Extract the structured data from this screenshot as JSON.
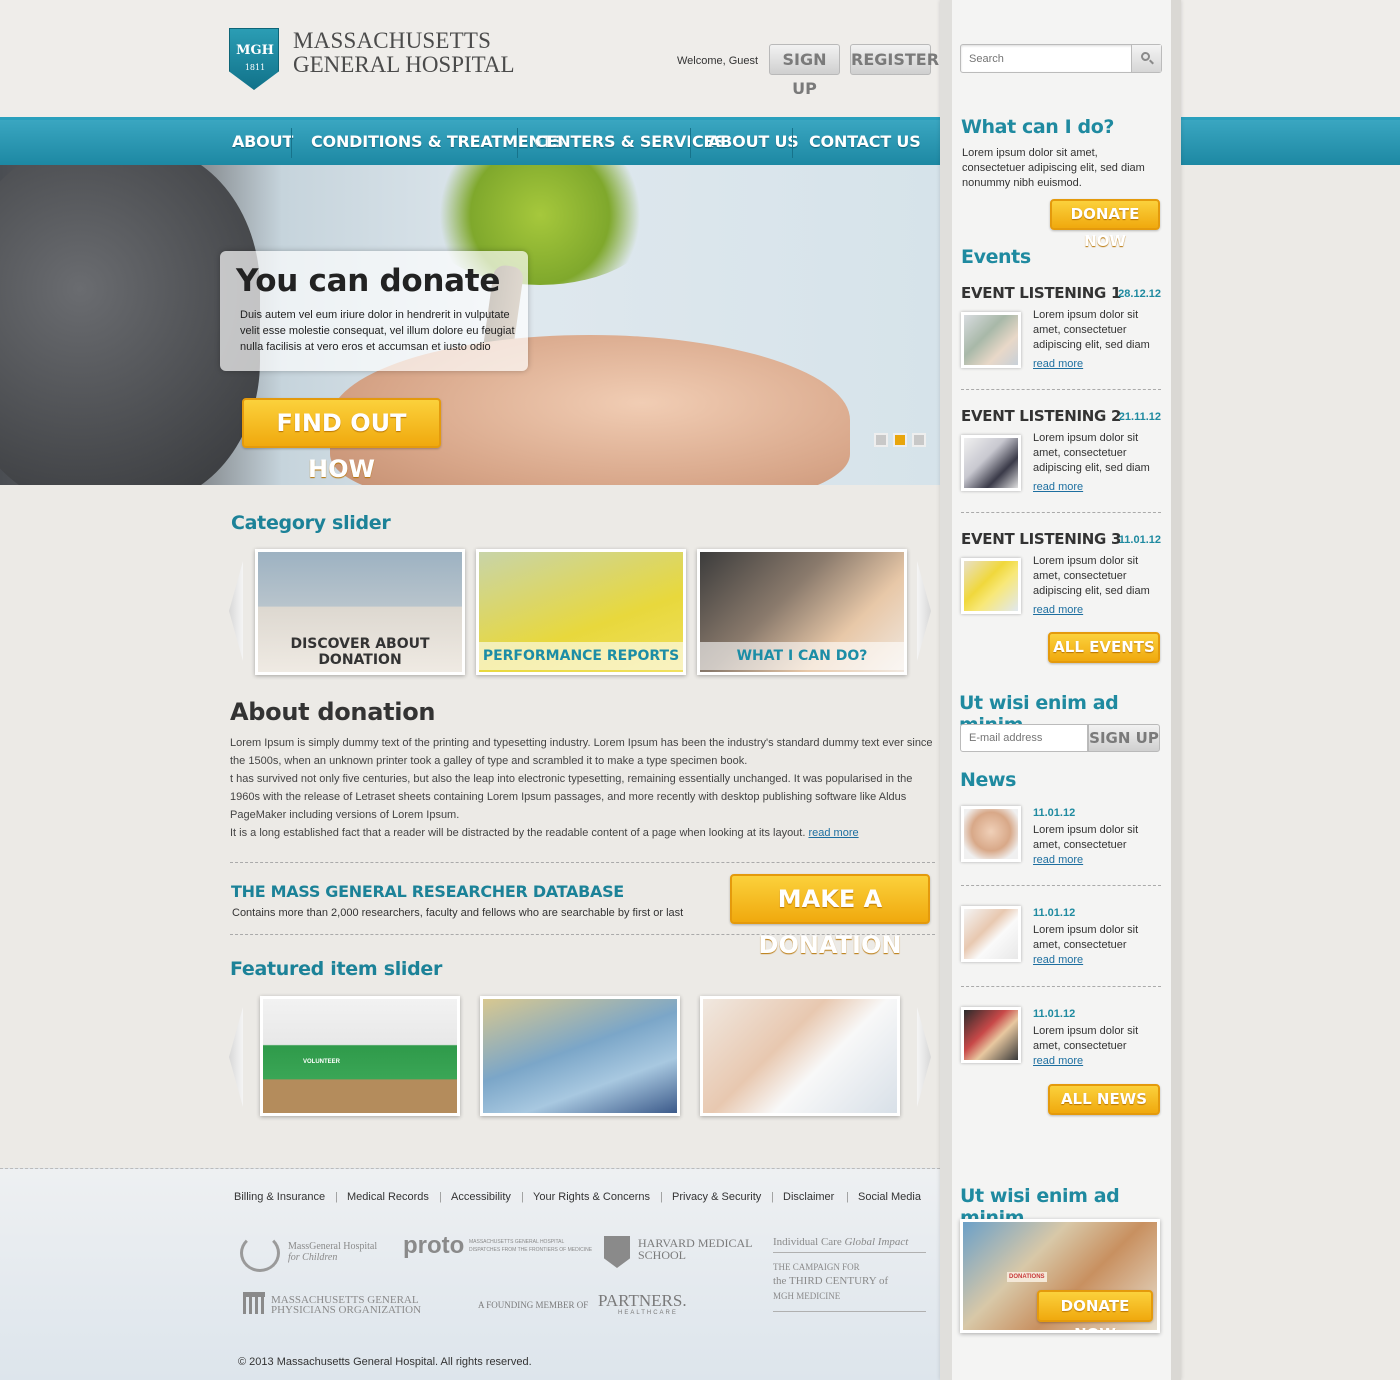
{
  "header": {
    "logo_badge": "MGH",
    "logo_year": "1811",
    "logo_line1": "MASSACHUSETTS",
    "logo_line2": "GENERAL HOSPITAL",
    "welcome": "Welcome, Guest",
    "signup": "SIGN UP",
    "register": "REGISTER",
    "search_placeholder": "Search"
  },
  "nav": [
    "ABOUT",
    "CONDITIONS & TREATMENTS",
    "CENTERS & SERVICES",
    "ABOUT US",
    "CONTACT US"
  ],
  "hero": {
    "title": "You can donate",
    "text": "Duis autem vel eum iriure dolor in hendrerit in vulputate velit esse molestie consequat, vel illum dolore eu feugiat nulla facilisis at vero eros et accumsan et iusto odio",
    "button": "FIND OUT HOW",
    "slides": 3,
    "active_slide": 2
  },
  "category": {
    "title": "Category slider",
    "items": [
      "DISCOVER ABOUT DONATION",
      "PERFORMANCE REPORTS",
      "WHAT I CAN DO?"
    ]
  },
  "about": {
    "title": "About donation",
    "p1": "Lorem Ipsum is simply dummy text of the printing and typesetting industry. Lorem Ipsum has been the industry's standard dummy text ever since the 1500s, when an unknown printer took a galley of type and scrambled it to make a type specimen book.",
    "p2": "t has survived not only five centuries, but also the leap into electronic typesetting, remaining essentially unchanged. It was popularised in the 1960s with the release of Letraset sheets containing Lorem Ipsum passages, and more recently with desktop publishing software like Aldus PageMaker including versions of Lorem Ipsum.",
    "p3": "It is a long established fact that a reader will be distracted by the readable content of a page when looking at its layout.",
    "read_more": "read more"
  },
  "database": {
    "title": "THE MASS GENERAL RESEARCHER DATABASE",
    "text": "Contains more than 2,000 researchers, faculty and fellows who are searchable by first or last",
    "button": "MAKE A DONATION"
  },
  "featured": {
    "title": "Featured item slider",
    "badge": "VOLUNTEER"
  },
  "footer": {
    "links": [
      "Billing & Insurance",
      "Medical Records",
      "Accessibility",
      "Your Rights & Concerns",
      "Privacy & Security",
      "Disclaimer",
      "Social Media"
    ],
    "logo1_a": "MassGeneral Hospital",
    "logo1_b": "for Children",
    "logo2_a": "proto",
    "logo2_b": "MASSACHUSETTS GENERAL HOSPITAL",
    "logo2_c": "DISPATCHES FROM THE FRONTIERS OF MEDICINE",
    "logo3_a": "HARVARD MEDICAL",
    "logo3_b": "SCHOOL",
    "logo4_a": "Individual Care",
    "logo4_b": "Global Impact",
    "logo4_c": "THE CAMPAIGN FOR",
    "logo4_d": "the THIRD CENTURY of",
    "logo4_e": "MGH MEDICINE",
    "logo5_a": "MASSACHUSETTS GENERAL",
    "logo5_b": "PHYSICIANS ORGANIZATION",
    "logo6_a": "A FOUNDING MEMBER OF",
    "logo6_b": "PARTNERS.",
    "logo6_c": "HEALTHCARE",
    "copyright": "© 2013 Massachusetts General Hospital. All rights reserved."
  },
  "sidebar": {
    "what_title": "What can I do?",
    "what_text": "Lorem ipsum dolor sit amet, consectetuer adipiscing elit, sed diam nonummy nibh euismod.",
    "donate": "DONATE NOW",
    "events_title": "Events",
    "events": [
      {
        "title": "EVENT LISTENING 1",
        "date": "28.12.12",
        "text": "Lorem ipsum dolor sit amet, consectetuer adipiscing elit, sed diam",
        "link": "read more"
      },
      {
        "title": "EVENT LISTENING 2",
        "date": "21.11.12",
        "text": "Lorem ipsum dolor sit amet, consectetuer adipiscing elit, sed diam",
        "link": "read more"
      },
      {
        "title": "EVENT LISTENING 3",
        "date": "11.01.12",
        "text": "Lorem ipsum dolor sit amet, consectetuer adipiscing elit, sed diam",
        "link": "read more"
      }
    ],
    "all_events": "ALL EVENTS",
    "newsletter_title": "Ut wisi enim ad minim",
    "email_placeholder": "E-mail address",
    "newsletter_signup": "SIGN UP",
    "news_title": "News",
    "news": [
      {
        "date": "11.01.12",
        "text": "Lorem ipsum dolor sit amet, consectetuer",
        "link": "read more"
      },
      {
        "date": "11.01.12",
        "text": "Lorem ipsum dolor sit amet, consectetuer",
        "link": "read more"
      },
      {
        "date": "11.01.12",
        "text": "Lorem ipsum dolor sit amet, consectetuer",
        "link": "read more"
      }
    ],
    "all_news": "ALL NEWS",
    "promo_title": "Ut wisi enim ad minim",
    "promo_button": "DONATE NOW",
    "promo_box_label": "DONATIONS"
  }
}
